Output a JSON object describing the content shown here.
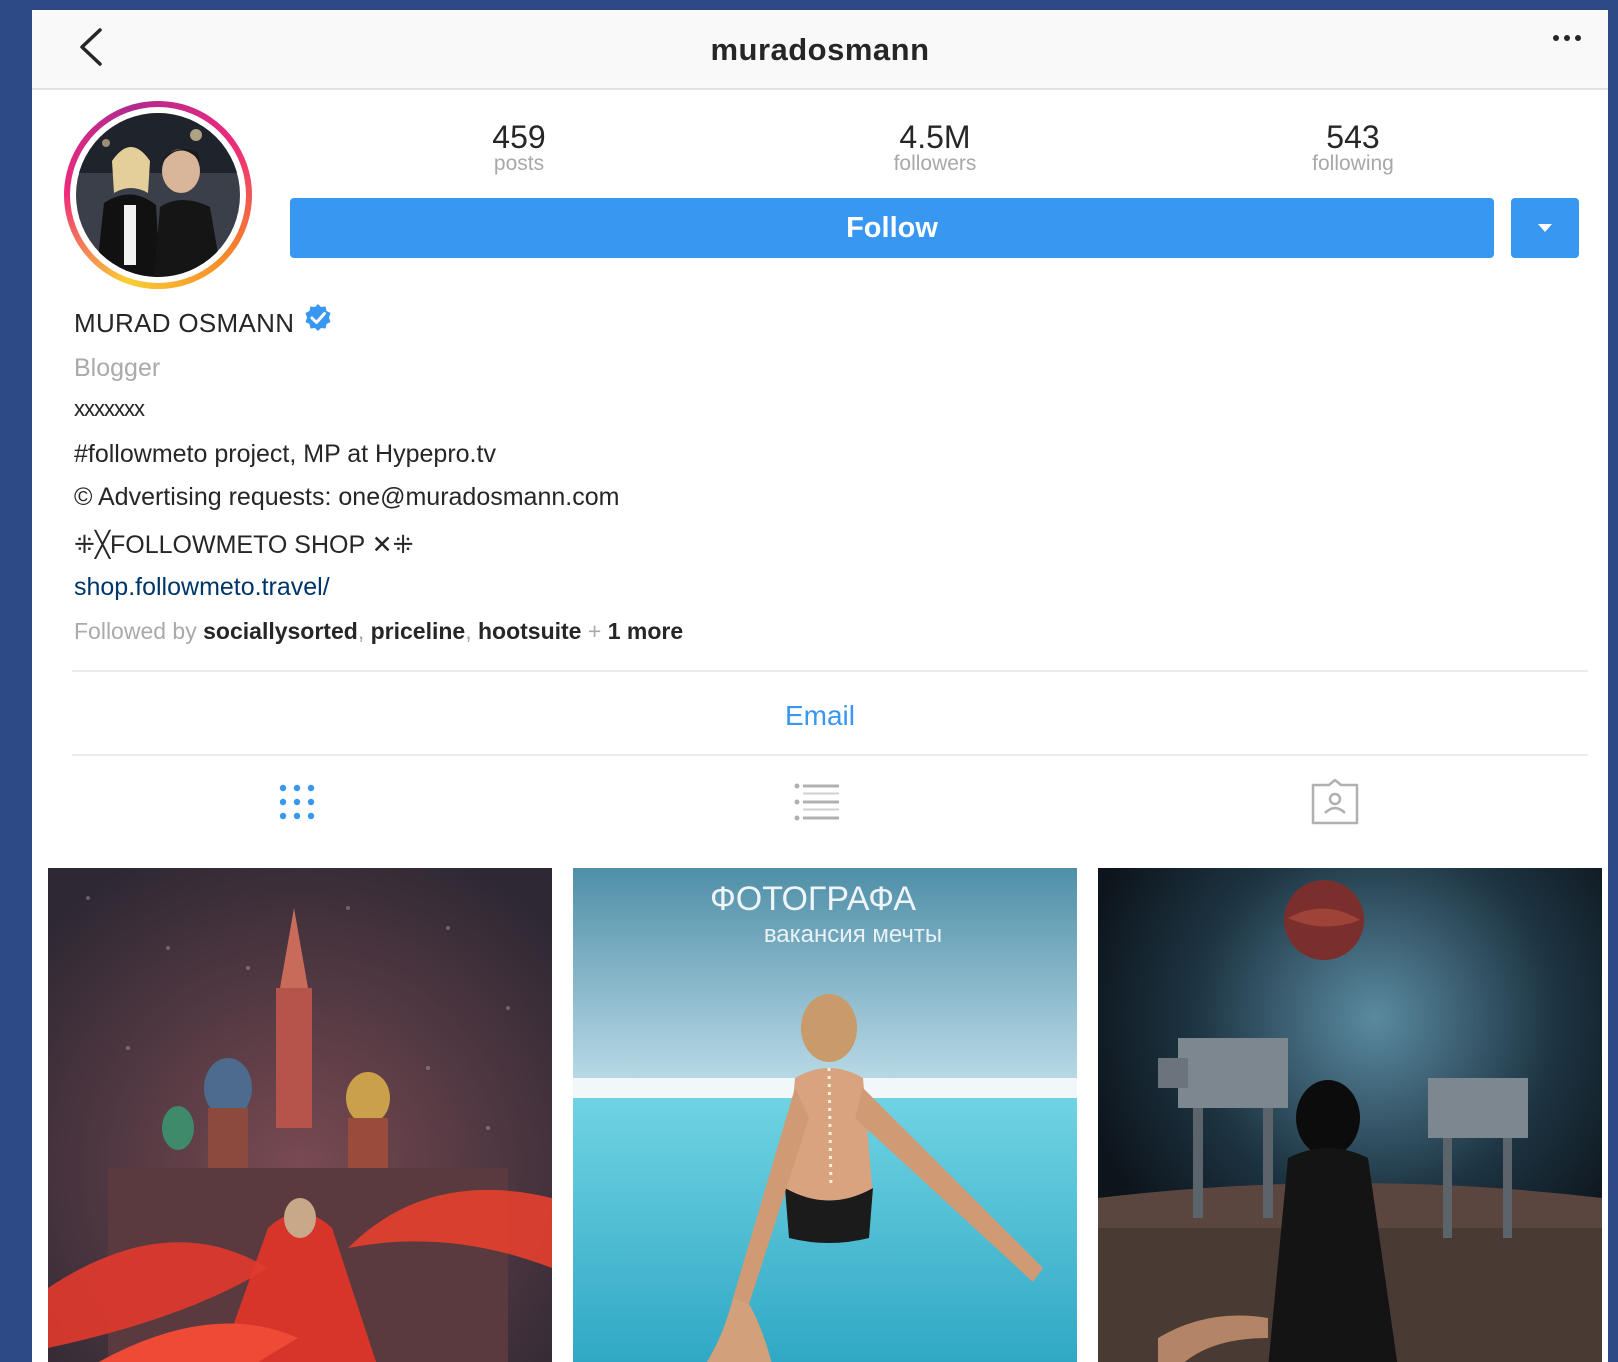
{
  "header": {
    "username": "muradosmann",
    "back_icon": "chevron-left-icon",
    "more_icon": "ellipsis-icon"
  },
  "profile": {
    "stats": {
      "posts_count": "459",
      "posts_label": "posts",
      "followers_count": "4.5M",
      "followers_label": "followers",
      "following_count": "543",
      "following_label": "following"
    },
    "follow_label": "Follow",
    "dropdown_icon": "caret-down-icon",
    "full_name": "MURAD OSMANN",
    "verified_icon": "verified-badge-icon",
    "category": "Blogger",
    "bio_lines": [
      "xxxxxxx",
      "#followmeto project, MP at Hypepro.tv",
      "© Advertising requests: one@muradosmann.com",
      "⁜╳FOLLOWMETO SHOP ✕⁜"
    ],
    "website": "shop.followmeto.travel/",
    "followed_by": {
      "prefix": "Followed by",
      "users": [
        "sociallysorted",
        "priceline",
        "hootsuite"
      ],
      "more": "1 more"
    },
    "email_label": "Email"
  },
  "tabs": [
    {
      "name": "grid",
      "icon": "grid-icon",
      "active": true
    },
    {
      "name": "list",
      "icon": "list-icon",
      "active": false
    },
    {
      "name": "tagged",
      "icon": "tagged-user-icon",
      "active": false
    }
  ],
  "posts": [
    {
      "alt_icon": "post-image-moscow"
    },
    {
      "alt_icon": "post-image-pool",
      "overlay_line1": "ФОТОГРАФА",
      "overlay_line2": "вакансия мечты"
    },
    {
      "alt_icon": "post-image-desert"
    }
  ],
  "colors": {
    "accent_blue": "#3897f0",
    "link_dark": "#003569",
    "page_bg": "#2e4a86"
  }
}
